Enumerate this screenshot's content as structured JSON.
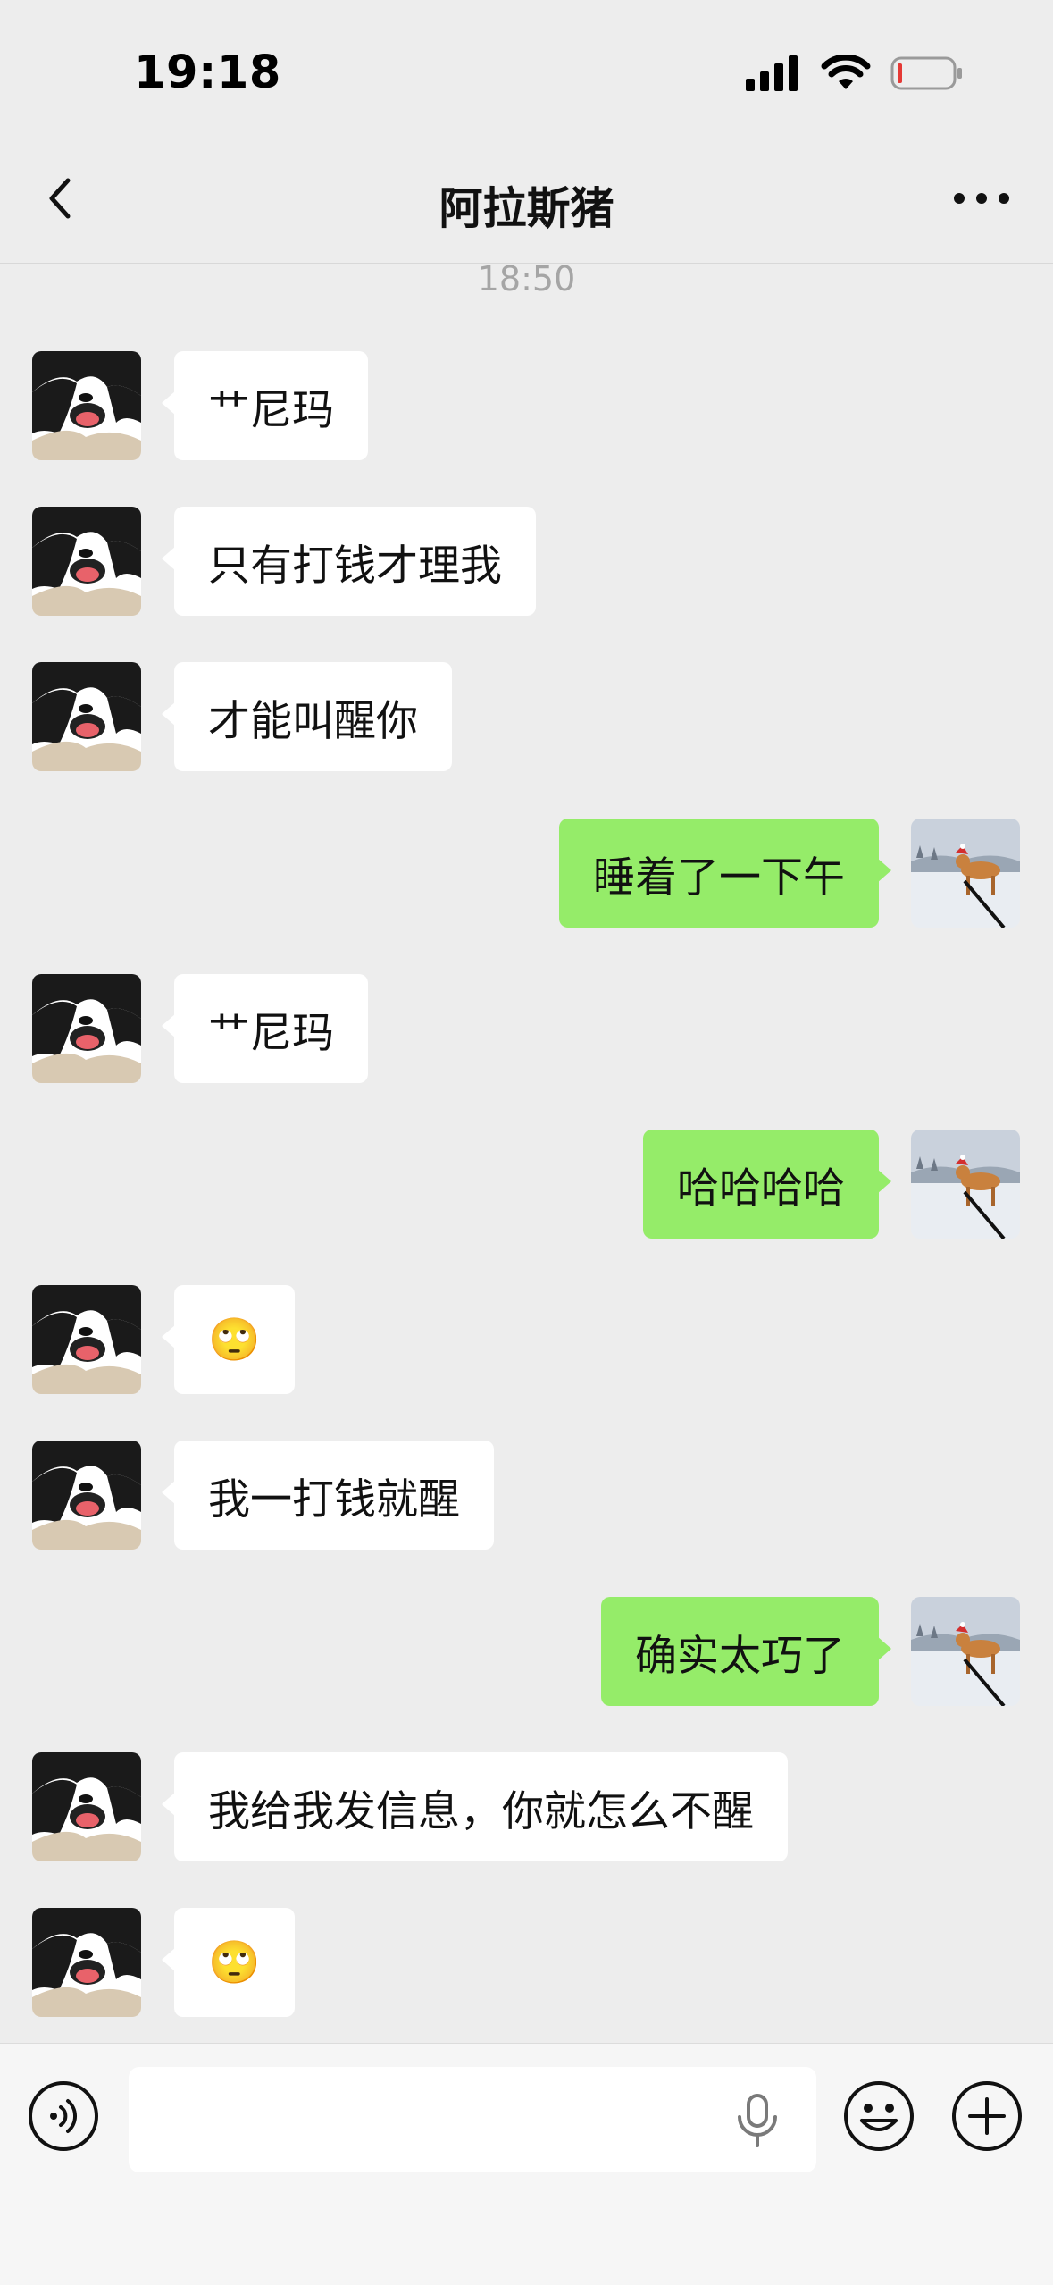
{
  "status_bar": {
    "time": "19:18"
  },
  "header": {
    "title": "阿拉斯猪"
  },
  "chat": {
    "timestamp": "18:50",
    "messages": [
      {
        "side": "in",
        "text": "艹尼玛"
      },
      {
        "side": "in",
        "text": "只有打钱才理我"
      },
      {
        "side": "in",
        "text": "才能叫醒你"
      },
      {
        "side": "out",
        "text": "睡着了一下午"
      },
      {
        "side": "in",
        "text": "艹尼玛"
      },
      {
        "side": "out",
        "text": "哈哈哈哈"
      },
      {
        "side": "in",
        "text": "🙄"
      },
      {
        "side": "in",
        "text": "我一打钱就醒"
      },
      {
        "side": "out",
        "text": "确实太巧了"
      },
      {
        "side": "in",
        "text": "我给我发信息，你就怎么不醒"
      },
      {
        "side": "in",
        "text": "🙄"
      }
    ]
  },
  "input": {
    "value": "",
    "placeholder": ""
  },
  "icons": {
    "back": "chevron-left-icon",
    "more": "more-dots-icon",
    "voice": "voice-icon",
    "mic": "microphone-icon",
    "emoji": "emoji-icon",
    "plus": "plus-icon"
  },
  "colors": {
    "background": "#ededed",
    "incoming_bubble": "#ffffff",
    "outgoing_bubble": "#95ec69",
    "battery_low": "#e53935"
  }
}
